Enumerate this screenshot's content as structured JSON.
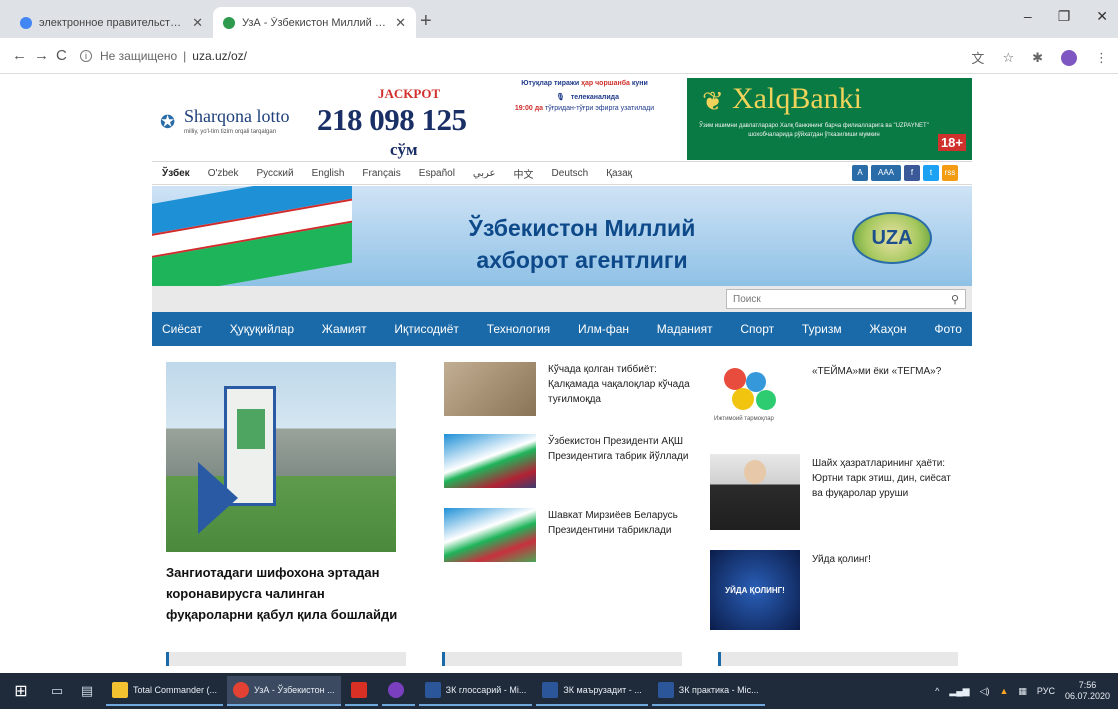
{
  "browser": {
    "tabs": [
      {
        "title": "электронное правительство К",
        "favicon_color": "#4285f4"
      },
      {
        "title": "УзА - Ўзбекистон Миллий ахбо",
        "favicon_color": "#2e9a4d"
      }
    ],
    "new_tab_symbol": "+",
    "close_symbol": "✕",
    "back": "←",
    "forward": "→",
    "reload": "C",
    "security_label": "Не защищено",
    "url": "uza.uz/oz/",
    "window_buttons": {
      "minimize": "–",
      "maximize": "❐",
      "close": "✕"
    }
  },
  "ads": {
    "lotto_name": "Sharqona lotto",
    "lotto_sub": "milliy, yo'l-tim tizim orqali tarqalgan",
    "jackpot_label": "JACKPOT",
    "jackpot_amount": "218 098 125",
    "currency": "сўм",
    "promo_line1_pre": "Ютуқлар тиражи ",
    "promo_line1_red": "ҳар чоршанба",
    "promo_line1_post": " куни",
    "promo_mid": "телеканалида",
    "promo_time": "19:00 да",
    "promo_line2": " тўғридан-тўғри эфирга узатилади",
    "bank_name": "XalqBanki",
    "bank_text": "Ўзим ишимни давлатлараро Халқ банкининг барча филиалларига ва \"UZPAYNET\" шохобчаларида рўйхатдан ўтказилиши мумкин",
    "age": "18+"
  },
  "languages": [
    "Ўзбек",
    "O'zbek",
    "Русский",
    "English",
    "Français",
    "Español",
    "عربي",
    "中文",
    "Deutsch",
    "Қазақ"
  ],
  "social": [
    {
      "label": "A",
      "color": "#2a6ca8"
    },
    {
      "label": "AAA",
      "color": "#2a6ca8"
    },
    {
      "label": "f",
      "color": "#3b5998"
    },
    {
      "label": "t",
      "color": "#1da1f2"
    },
    {
      "label": "rss",
      "color": "#f39c12"
    }
  ],
  "banner": {
    "title": "Ўзбекистон Миллий ахборот агентлиги",
    "logo_text": "UZA"
  },
  "search": {
    "placeholder": "Поиск",
    "icon": "magnifier-icon"
  },
  "nav": [
    "Сиёсат",
    "Ҳуқуқийлар",
    "Жамият",
    "Иқтисодиёт",
    "Технология",
    "Илм-фан",
    "Маданият",
    "Спорт",
    "Туризм",
    "Жаҳон",
    "Фото"
  ],
  "featured": {
    "title": "Зангиотадаги шифохона эртадан коронавирусга чалинган фуқароларни қабул қила бошлайди"
  },
  "mid_news": [
    {
      "title": "Кўчада қолган тиббиёт: Қалқамада чақалоқлар кўчада туғилмоқда",
      "thumb_color": "#a9957a"
    },
    {
      "title": "Ўзбекистон Президенти АҚШ Президентига табрик йўллади",
      "thumb_color": "#3d7bc2"
    },
    {
      "title": "Шавкат Мирзиёев Беларусь Президентини табриклади",
      "thumb_color": "#46a35a"
    }
  ],
  "right_news": [
    {
      "title": "«ТЕЙМА»ми ёки «ТЕГМА»?",
      "thumb_caption": "Ижтимоий тармоқлар"
    },
    {
      "title": "Шайх ҳазратларининг ҳаёти: Юртни тарк этиш, дин, сиёсат ва фуқаролар уруши"
    },
    {
      "title": "Уйда қолинг!",
      "thumb_caption": "УЙДА ҚОЛИНГ!"
    }
  ],
  "taskbar": {
    "apps": [
      {
        "label": "Total Commander (...",
        "color": "#f2c230"
      },
      {
        "label": "УзА - Ўзбекистон ...",
        "color": "#e34133",
        "active": true
      },
      {
        "label": "",
        "color": "#d93025"
      },
      {
        "label": "",
        "color": "#7a3fbf"
      },
      {
        "label": "ЗК глоссарий - Mi...",
        "color": "#2b579a"
      },
      {
        "label": "ЗК маърузадит - ...",
        "color": "#2b579a"
      },
      {
        "label": "ЗК практика - Mic...",
        "color": "#2b579a"
      }
    ],
    "tray_lang": "РУС",
    "time": "7:56",
    "date": "06.07.2020"
  }
}
